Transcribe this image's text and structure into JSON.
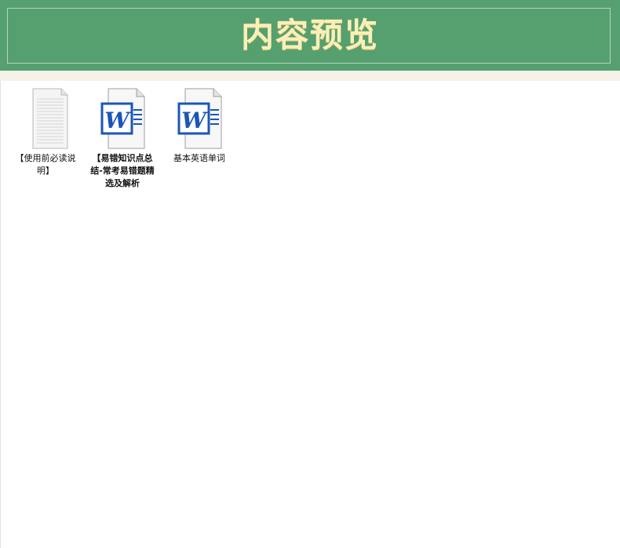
{
  "header": {
    "title": "内容预览"
  },
  "files": [
    {
      "name": "【使用前必读说明】",
      "icon": "text-document-icon"
    },
    {
      "name": "【易错知识点总结-常考易错题精选及解析",
      "icon": "word-document-icon"
    },
    {
      "name": "基本英语单词",
      "icon": "word-document-icon"
    }
  ],
  "colors": {
    "header_bg": "#56a06f",
    "title": "#fbefb8",
    "word_blue": "#1b56b6"
  }
}
